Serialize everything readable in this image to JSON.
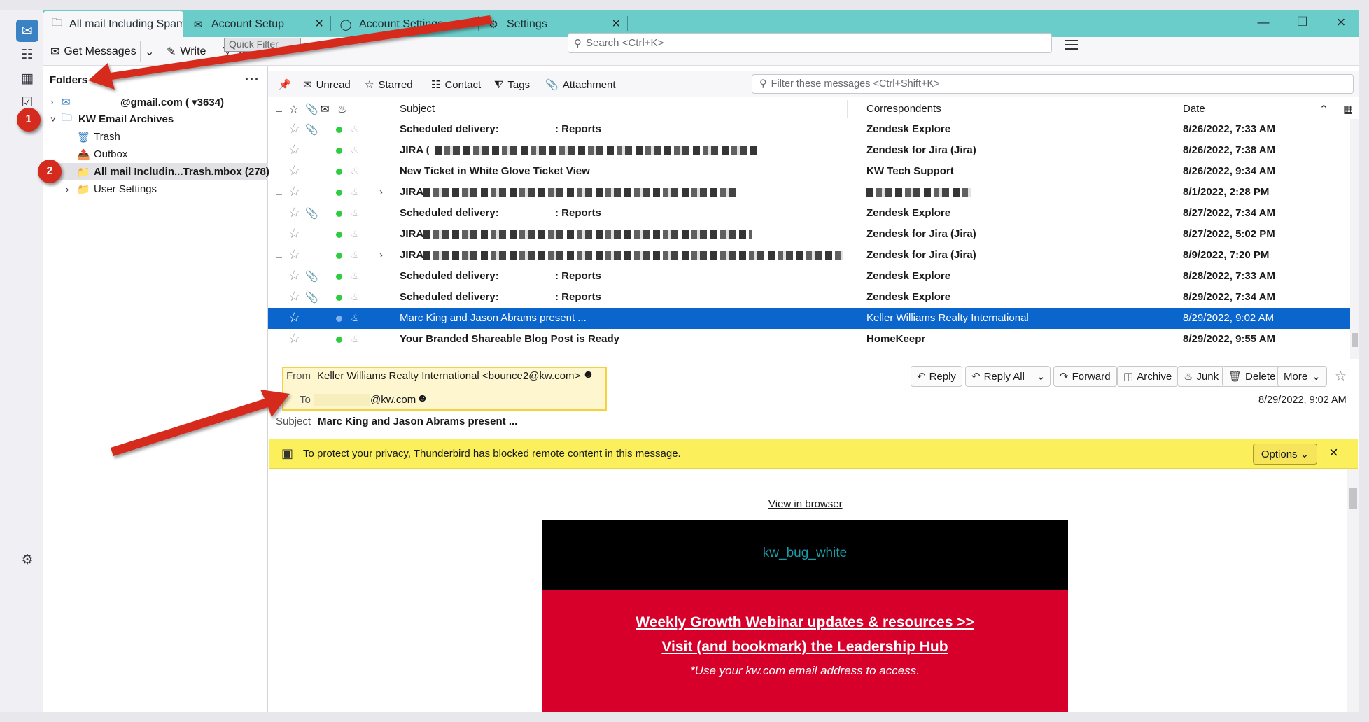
{
  "tabs": [
    {
      "label": "All mail Including Spam and Tr",
      "fade": "a",
      "icon": "folder-icon"
    },
    {
      "label": "Account Setup",
      "icon": "account-setup-icon"
    },
    {
      "label": "Account Settings",
      "icon": "account-settings-icon"
    },
    {
      "label": "Settings",
      "icon": "gear-icon"
    }
  ],
  "toolbar": {
    "get_messages": "Get Messages",
    "write": "Write",
    "tag": "Tag",
    "quick_filter": "Quick Filter",
    "search_placeholder": "Search <Ctrl+K>"
  },
  "folders": {
    "header": "Folders",
    "more": "···",
    "items": [
      {
        "label": "@gmail.com ( ▾3634)",
        "icon": "email-account-icon",
        "level": 0,
        "twisty": "›",
        "bold": true
      },
      {
        "label": "KW Email Archives",
        "icon": "local-folders-icon",
        "level": 0,
        "twisty": "˅",
        "bold": true
      },
      {
        "label": "Trash",
        "icon": "trash-icon",
        "level": 1
      },
      {
        "label": "Outbox",
        "icon": "outbox-icon",
        "level": 1
      },
      {
        "label": "All mail Includin...Trash.mbox (278)",
        "icon": "folder-icon",
        "level": 1,
        "bold": true,
        "selected": true
      },
      {
        "label": "User Settings",
        "icon": "folder-icon",
        "level": 1,
        "twisty": "›"
      }
    ]
  },
  "quickfilter": {
    "unread": "Unread",
    "starred": "Starred",
    "contact": "Contact",
    "tags": "Tags",
    "attachment": "Attachment",
    "filter_placeholder": "Filter these messages <Ctrl+Shift+K>"
  },
  "thread_columns": {
    "subject": "Subject",
    "correspondents": "Correspondents",
    "date": "Date"
  },
  "messages": [
    {
      "subject": "Scheduled delivery:",
      "subject_suffix": ": Reports",
      "correspondent": "Zendesk Explore",
      "date": "8/26/2022, 7:33 AM",
      "attach": true,
      "bold": true
    },
    {
      "subject": "JIRA (",
      "redacted": 460,
      "correspondent": "Zendesk for Jira (Jira)",
      "date": "8/26/2022, 7:38 AM",
      "bold": true
    },
    {
      "subject": "New Ticket in White Glove Ticket View",
      "correspondent": "KW Tech Support",
      "date": "8/26/2022, 9:34 AM",
      "bold": true
    },
    {
      "subject": "JIRA",
      "redacted": 450,
      "correspondent": "",
      "correspondent_redacted": 150,
      "date": "8/1/2022, 2:28 PM",
      "bold": true,
      "thread": true
    },
    {
      "subject": "Scheduled delivery:",
      "subject_suffix": ": Reports",
      "correspondent": "Zendesk Explore",
      "date": "8/27/2022, 7:34 AM",
      "attach": true,
      "bold": true
    },
    {
      "subject": "JIRA",
      "redacted": 470,
      "correspondent": "Zendesk for Jira (Jira)",
      "date": "8/27/2022, 5:02 PM",
      "bold": true
    },
    {
      "subject": "JIRA",
      "redacted": 600,
      "correspondent": "Zendesk for Jira (Jira)",
      "date": "8/9/2022, 7:20 PM",
      "bold": true,
      "thread": true
    },
    {
      "subject": "Scheduled delivery:",
      "subject_suffix": ": Reports",
      "correspondent": "Zendesk Explore",
      "date": "8/28/2022, 7:33 AM",
      "attach": true,
      "bold": true
    },
    {
      "subject": "Scheduled delivery:",
      "subject_suffix": ": Reports",
      "correspondent": "Zendesk Explore",
      "date": "8/29/2022, 7:34 AM",
      "attach": true,
      "bold": true
    },
    {
      "subject": "Marc King and Jason Abrams present ...",
      "correspondent": "Keller Williams Realty International",
      "date": "8/29/2022, 9:02 AM",
      "selected": true
    },
    {
      "subject": "Your Branded Shareable Blog Post is Ready",
      "correspondent": "HomeKeepr",
      "date": "8/29/2022, 9:55 AM",
      "bold": true
    }
  ],
  "header": {
    "from_label": "From",
    "from_value": "Keller Williams Realty International <bounce2@kw.com>",
    "to_label": "To",
    "to_value": "@kw.com",
    "subject_label": "Subject",
    "subject_value": "Marc King and Jason Abrams present ...",
    "date": "8/29/2022, 9:02 AM",
    "buttons": {
      "reply": "Reply",
      "reply_all": "Reply All",
      "forward": "Forward",
      "archive": "Archive",
      "junk": "Junk",
      "delete": "Delete",
      "more": "More"
    }
  },
  "remote_content": {
    "message": "To protect your privacy, Thunderbird has blocked remote content in this message.",
    "options": "Options"
  },
  "body": {
    "view_in_browser": "View in browser",
    "bug_alt": "kw_bug_white",
    "line1": "Weekly Growth Webinar updates & resources >>",
    "line2": "Visit (and bookmark) the Leadership Hub",
    "line3": "*Use your kw.com email address to access."
  },
  "annotations": {
    "badge1": "1",
    "badge2": "2"
  },
  "colors": {
    "tabbar": "#6bcdca",
    "selected_row": "#0a65cc",
    "remote_bar": "#fbef5b",
    "annotation_red": "#d52b1e",
    "kw_red": "#d6002a"
  }
}
